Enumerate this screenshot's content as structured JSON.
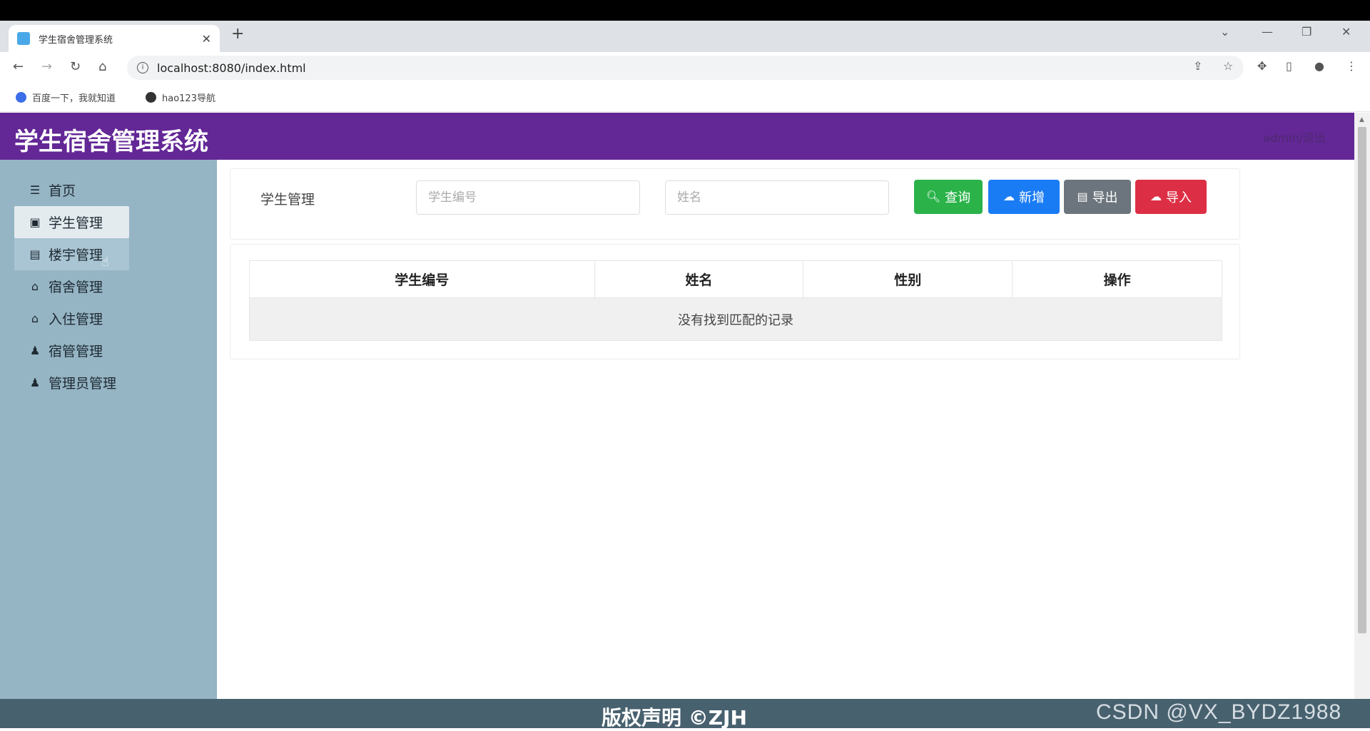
{
  "browser": {
    "tab_title": "学生宿舍管理系统",
    "tab_close": "✕",
    "new_tab": "+",
    "url": "localhost:8080/index.html",
    "bookmarks": [
      {
        "label": "百度一下，我就知道"
      },
      {
        "label": "hao123导航"
      }
    ]
  },
  "header": {
    "brand": "学生宿舍管理系统",
    "logout": "admin/退出"
  },
  "sidebar": {
    "items": [
      {
        "label": "首页",
        "icon": "☰"
      },
      {
        "label": "学生管理",
        "icon": "▣"
      },
      {
        "label": "楼宇管理",
        "icon": "▤"
      },
      {
        "label": "宿舍管理",
        "icon": "⌂"
      },
      {
        "label": "入住管理",
        "icon": "⌂"
      },
      {
        "label": "宿管管理",
        "icon": "♟"
      },
      {
        "label": "管理员管理",
        "icon": "♟"
      }
    ]
  },
  "search": {
    "panel_label": "学生管理",
    "student_no_placeholder": "学生编号",
    "name_placeholder": "姓名",
    "query_label": "查询",
    "add_label": "新增",
    "export_label": "导出",
    "import_label": "导入"
  },
  "colors": {
    "header": "#632796",
    "query": "#2bb34a",
    "add": "#1a7cf5",
    "export": "#6c757d",
    "import": "#dc2f45"
  },
  "table": {
    "columns": [
      "学生编号",
      "姓名",
      "性别",
      "操作"
    ],
    "empty_text": "没有找到匹配的记录"
  },
  "footer": {
    "copyright": "版权声明 ©ZJH",
    "watermark": "CSDN @VX_BYDZ1988"
  }
}
